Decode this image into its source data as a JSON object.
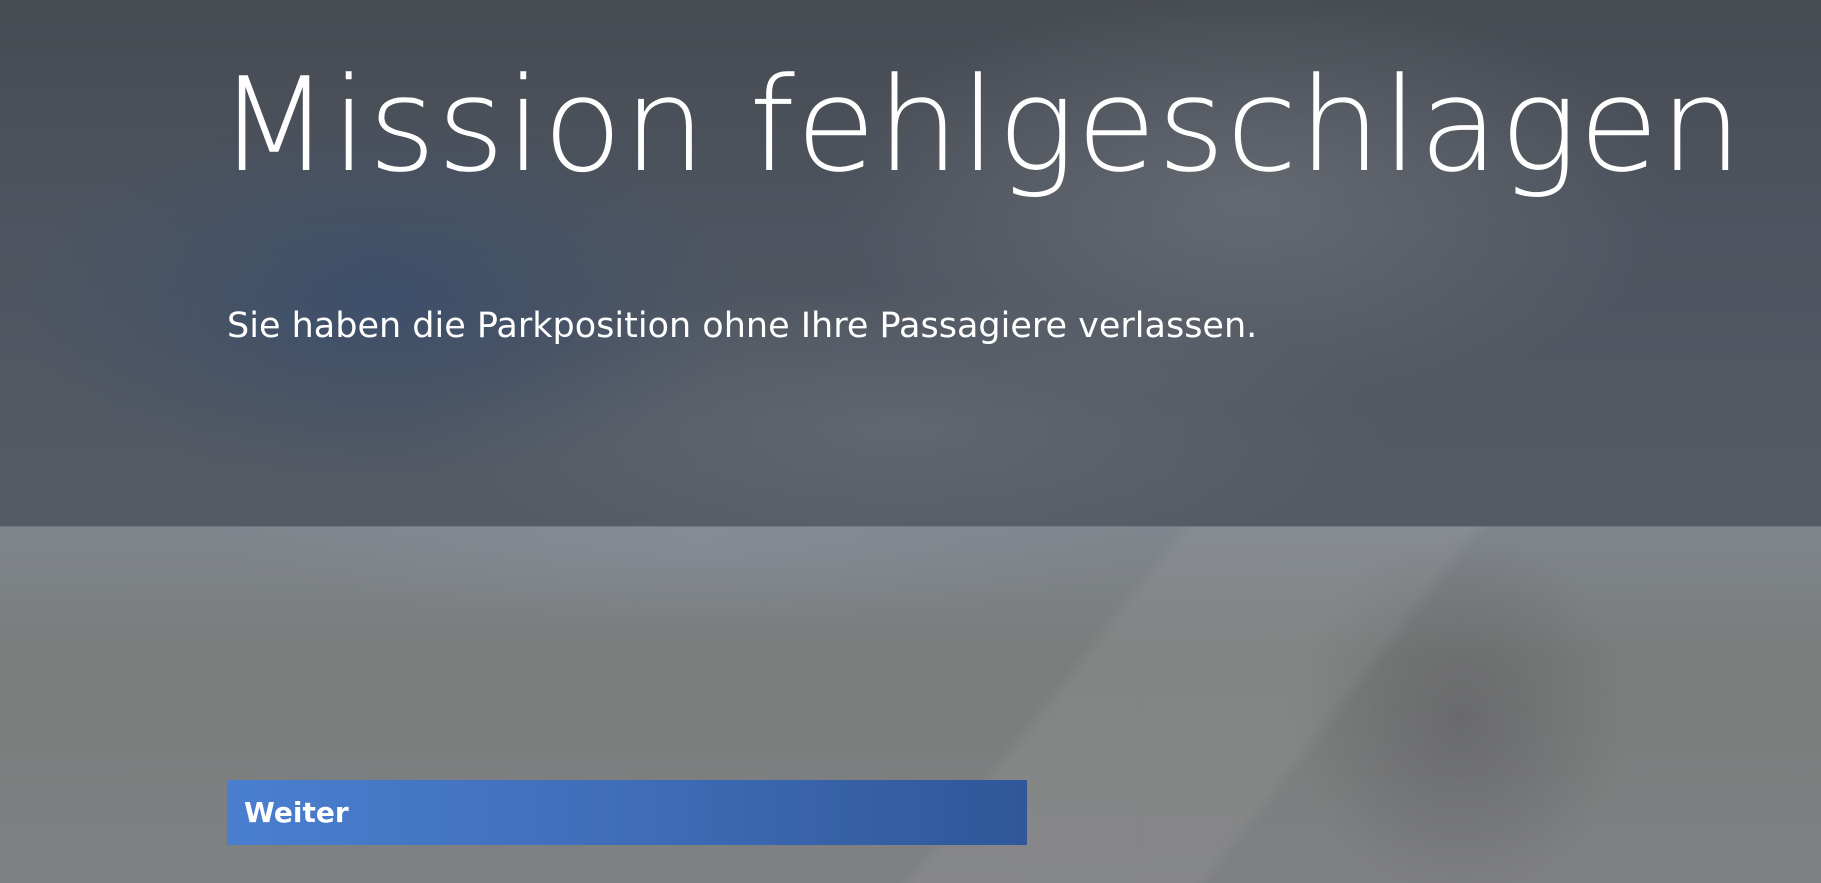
{
  "screen": {
    "title": "Mission fehlgeschlagen",
    "message": "Sie haben die Parkposition ohne Ihre Passagiere verlassen.",
    "continue_label": "Weiter"
  },
  "colors": {
    "accent": "#3f6db8",
    "text": "#ffffff"
  }
}
